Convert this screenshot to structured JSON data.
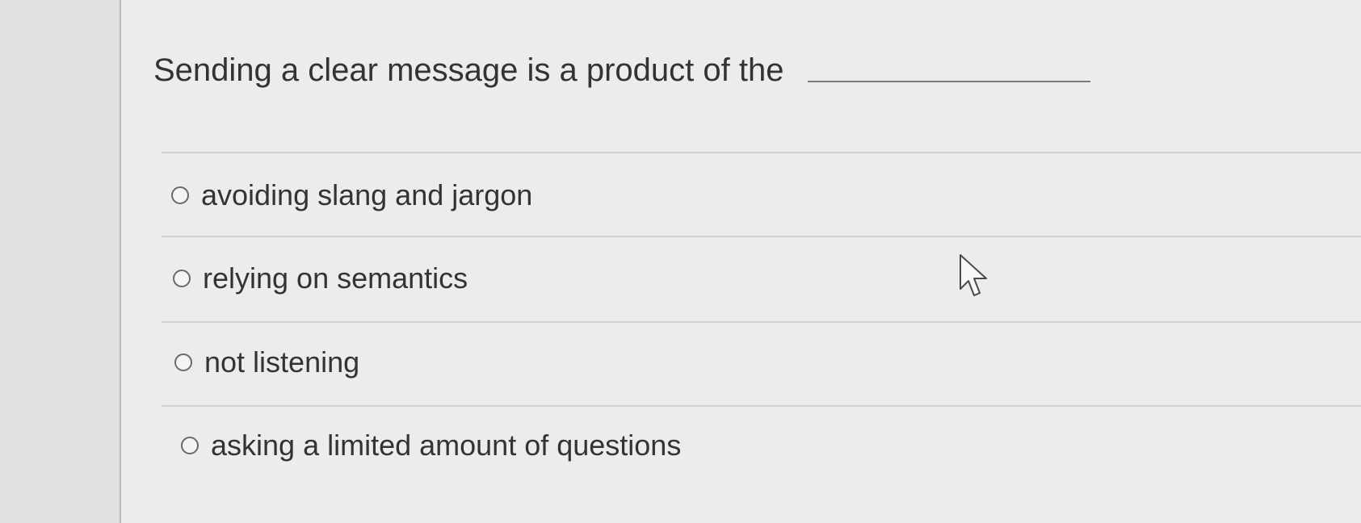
{
  "question": {
    "text": "Sending a clear message is a product of the"
  },
  "options": [
    {
      "label": "avoiding slang and jargon",
      "selected": false
    },
    {
      "label": "relying on semantics",
      "selected": false
    },
    {
      "label": "not listening",
      "selected": false
    },
    {
      "label": "asking a limited amount of questions",
      "selected": false
    }
  ]
}
